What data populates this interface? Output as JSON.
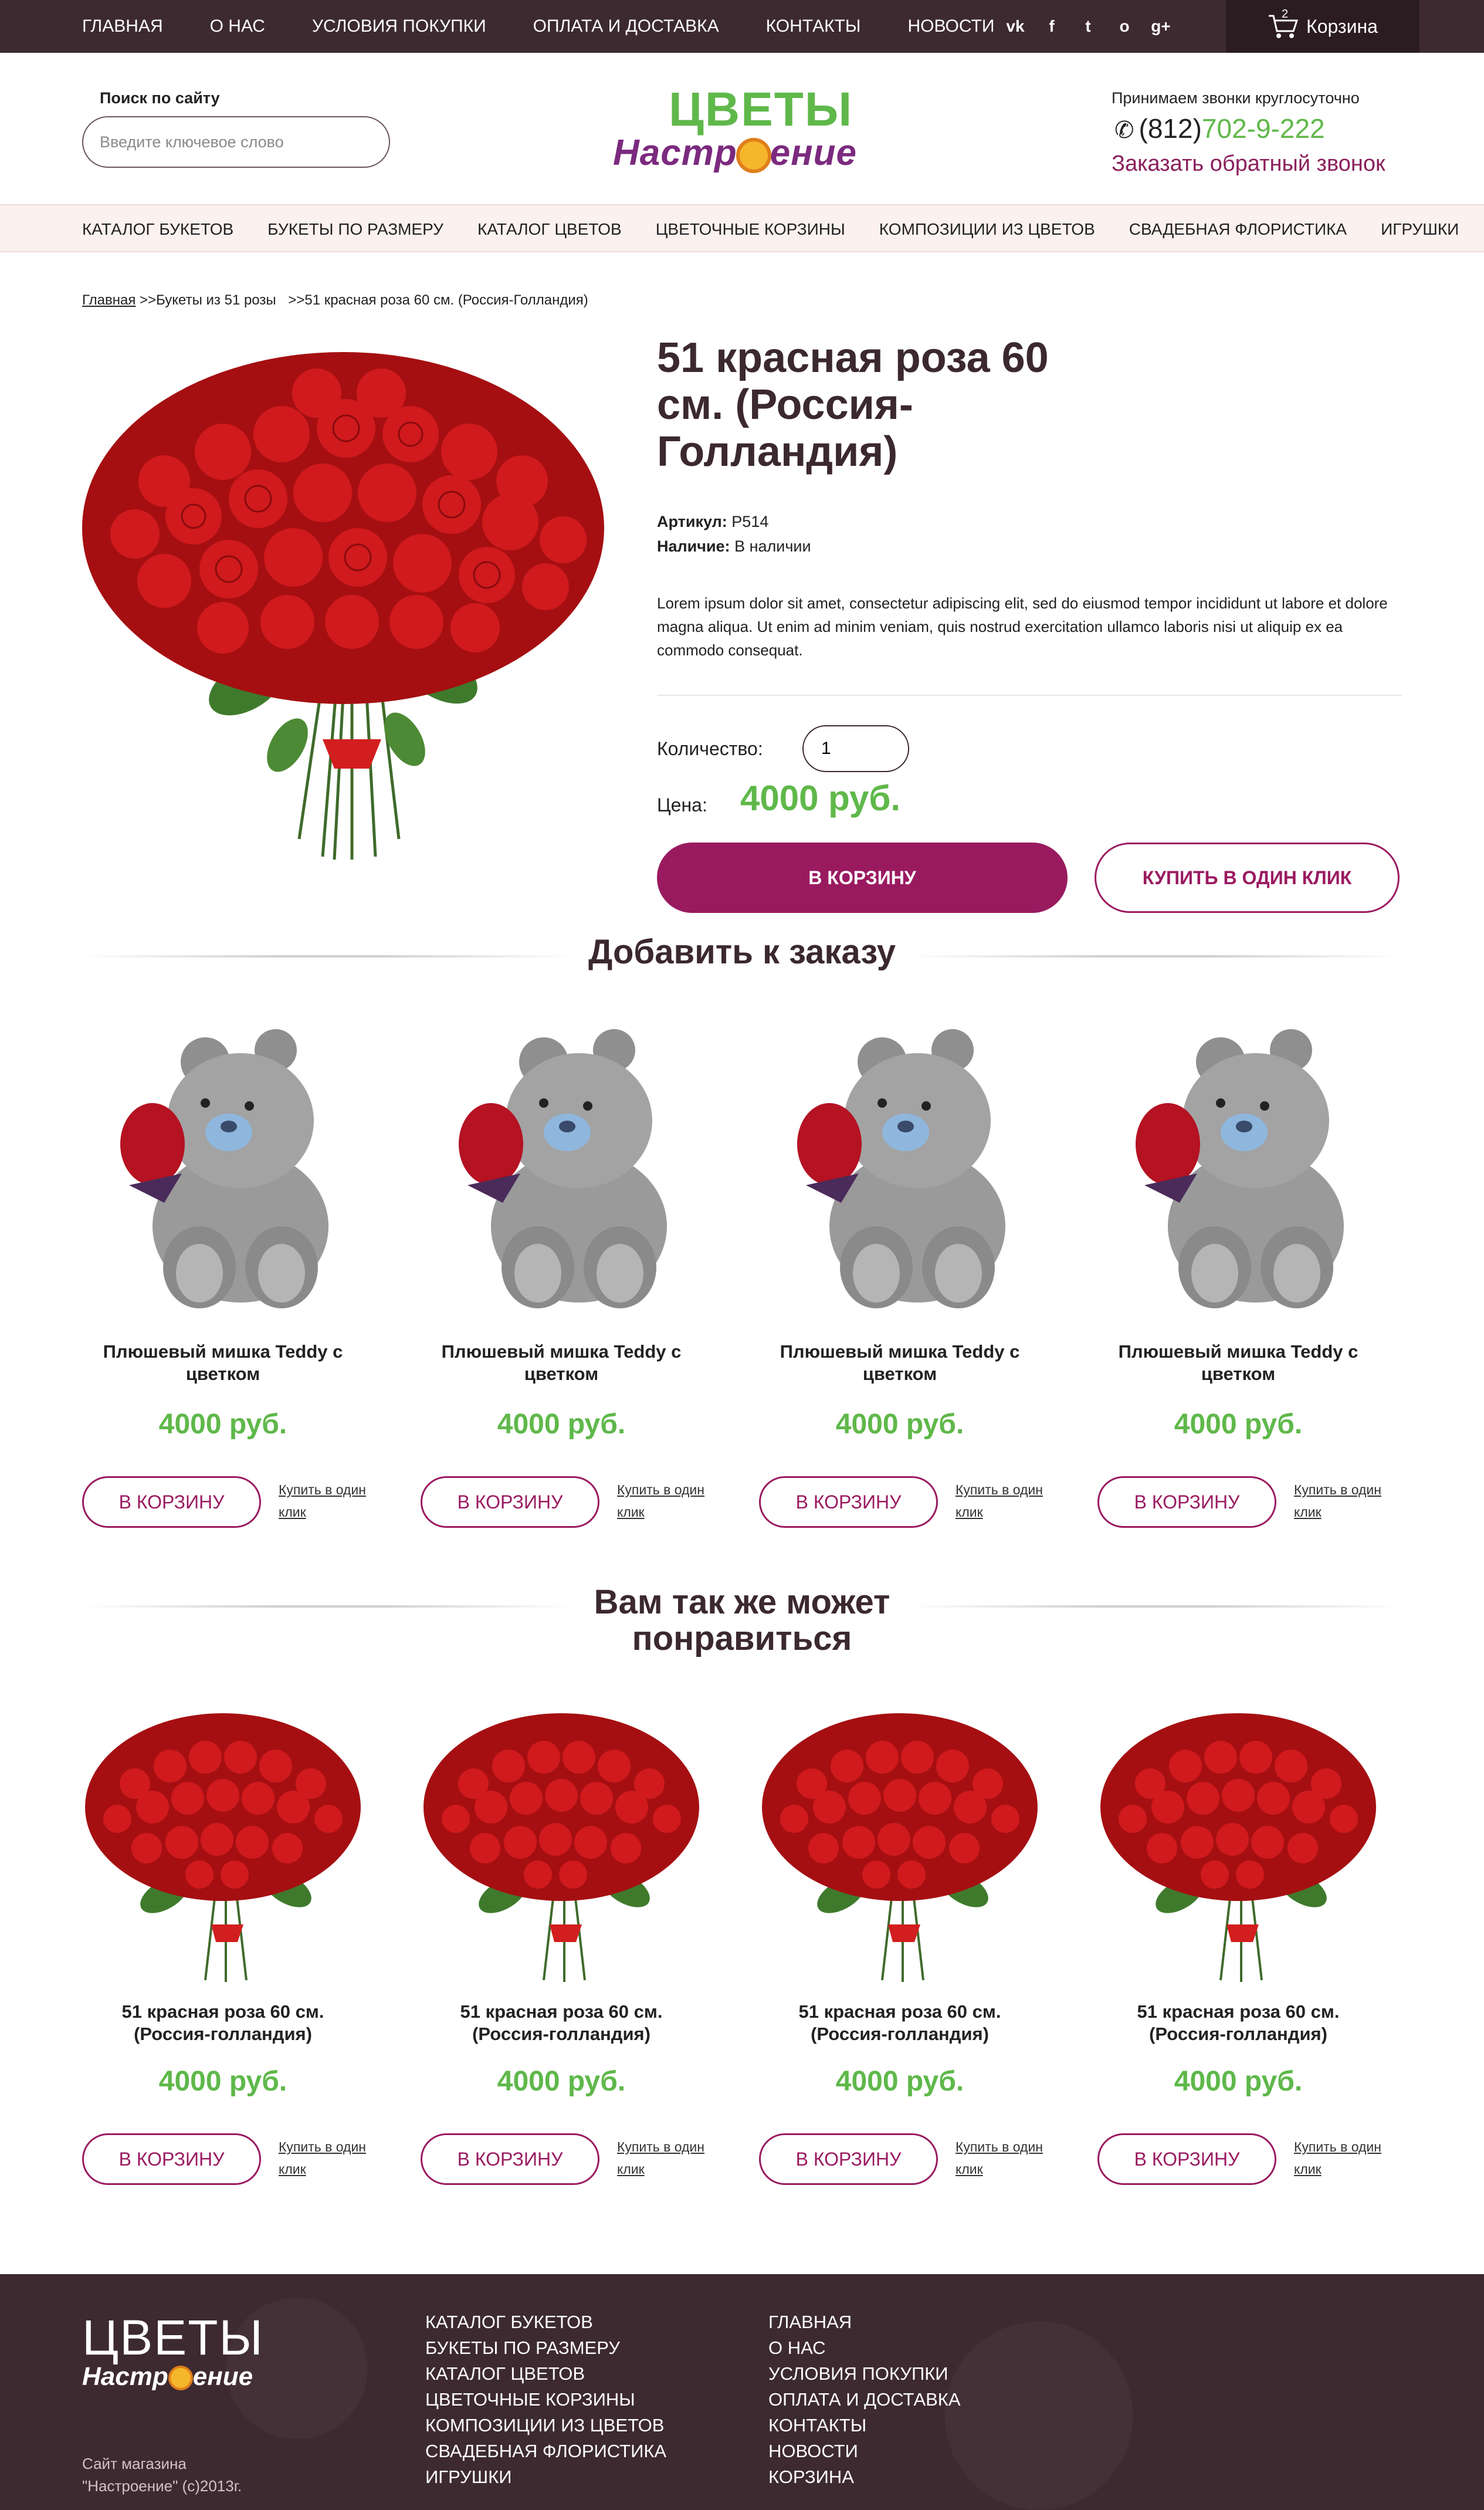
{
  "topnav": {
    "items": [
      "ГЛАВНАЯ",
      "О НАС",
      "УСЛОВИЯ ПОКУПКИ",
      "ОПЛАТА И ДОСТАВКА",
      "КОНТАКТЫ",
      "НОВОСТИ"
    ]
  },
  "social": {
    "icons": [
      "vk-icon",
      "facebook-icon",
      "twitter-icon",
      "odnoklassniki-icon",
      "googleplus-icon"
    ],
    "glyphs": [
      "vk",
      "f",
      "t",
      "o",
      "g+"
    ]
  },
  "cart": {
    "label": "Корзина",
    "count": "2"
  },
  "header": {
    "search_label": "Поиск по сайту",
    "search_placeholder": "Введите ключевое слово",
    "logo_top": "ЦВЕТЫ",
    "logo_bottom_a": "Настр",
    "logo_bottom_b": "ение",
    "hours": "Принимаем звонки круглосуточно",
    "phone_code": "(812)",
    "phone_number": "702-9-222",
    "callback": "Заказать обратный звонок"
  },
  "catnav": {
    "items": [
      "КАТАЛОГ БУКЕТОВ",
      "БУКЕТЫ ПО РАЗМЕРУ",
      "КАТАЛОГ ЦВЕТОВ",
      "ЦВЕТОЧНЫЕ КОРЗИНЫ",
      "КОМПОЗИЦИИ ИЗ ЦВЕТОВ",
      "СВАДЕБНАЯ ФЛОРИСТИКА",
      "ИГРУШКИ"
    ]
  },
  "breadcrumb": {
    "home": "Главная",
    "level1": ">>Букеты из 51 розы",
    "level2": ">>51 красная роза 60 см. (Россия-Голландия)"
  },
  "product": {
    "title": "51 красная роза 60 см. (Россия-Голландия)",
    "sku_label": "Артикул:",
    "sku": "Р514",
    "stock_label": "Наличие:",
    "stock": "В наличии",
    "description": "Lorem ipsum dolor sit amet, consectetur adipiscing elit, sed do eiusmod tempor incididunt ut labore et dolore magna aliqua. Ut enim ad minim veniam, quis nostrud exercitation ullamco laboris nisi ut aliquip ex ea commodo consequat.",
    "qty_label": "Количество:",
    "qty": "1",
    "price_label": "Цена:",
    "price": "4000 руб.",
    "cart_button": "В КОРЗИНУ",
    "oneclick_button": "КУПИТЬ В ОДИН КЛИК"
  },
  "addons": {
    "heading": "Добавить к заказу",
    "items": [
      {
        "name": "Плюшевый мишка Teddy с цветком",
        "price": "4000 руб.",
        "cart": "В КОРЗИНУ",
        "oneclick": "Купить в один клик"
      },
      {
        "name": "Плюшевый мишка Teddy с цветком",
        "price": "4000 руб.",
        "cart": "В КОРЗИНУ",
        "oneclick": "Купить в один клик"
      },
      {
        "name": "Плюшевый мишка Teddy с цветком",
        "price": "4000 руб.",
        "cart": "В КОРЗИНУ",
        "oneclick": "Купить в один клик"
      },
      {
        "name": "Плюшевый мишка Teddy с цветком",
        "price": "4000 руб.",
        "cart": "В КОРЗИНУ",
        "oneclick": "Купить в один клик"
      }
    ]
  },
  "related": {
    "heading": "Вам так же может понравиться",
    "items": [
      {
        "name": "51 красная роза 60 см. (Россия-голландия)",
        "price": "4000 руб.",
        "cart": "В КОРЗИНУ",
        "oneclick": "Купить в один клик"
      },
      {
        "name": "51 красная роза 60 см. (Россия-голландия)",
        "price": "4000 руб.",
        "cart": "В КОРЗИНУ",
        "oneclick": "Купить в один клик"
      },
      {
        "name": "51 красная роза 60 см. (Россия-голландия)",
        "price": "4000 руб.",
        "cart": "В КОРЗИНУ",
        "oneclick": "Купить в один клик"
      },
      {
        "name": "51 красная роза 60 см. (Россия-голландия)",
        "price": "4000 руб.",
        "cart": "В КОРЗИНУ",
        "oneclick": "Купить в один клик"
      }
    ]
  },
  "footer": {
    "logo_top": "ЦВЕТЫ",
    "logo_bottom_a": "Настр",
    "logo_bottom_b": "ение",
    "copyright": "Сайт магазина \"Настроение\" (с)2013г.",
    "col1": [
      "КАТАЛОГ БУКЕТОВ",
      "БУКЕТЫ ПО РАЗМЕРУ",
      "КАТАЛОГ ЦВЕТОВ",
      "ЦВЕТОЧНЫЕ КОРЗИНЫ",
      "КОМПОЗИЦИИ ИЗ ЦВЕТОВ",
      "СВАДЕБНАЯ ФЛОРИСТИКА",
      "ИГРУШКИ"
    ],
    "col2": [
      "ГЛАВНАЯ",
      "О НАС",
      "УСЛОВИЯ ПОКУПКИ",
      "ОПЛАТА И ДОСТАВКА",
      "КОНТАКТЫ",
      "НОВОСТИ",
      "КОРЗИНА"
    ]
  },
  "colors": {
    "topbar": "#3d2a31",
    "accent": "#9a1a60",
    "price_green": "#5fb84a",
    "logo_purple": "#7b2a7e"
  }
}
